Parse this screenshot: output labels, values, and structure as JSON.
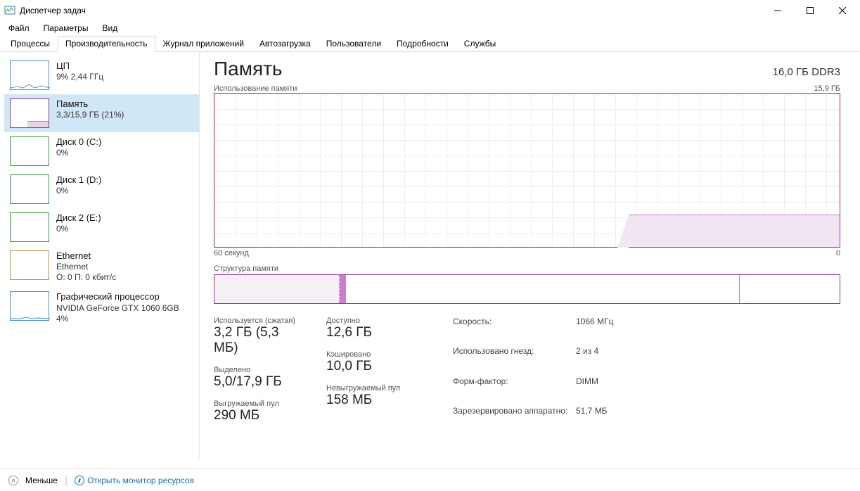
{
  "window": {
    "title": "Диспетчер задач"
  },
  "menu": {
    "file": "Файл",
    "options": "Параметры",
    "view": "Вид"
  },
  "tabs": {
    "processes": "Процессы",
    "performance": "Производительность",
    "app_history": "Журнал приложений",
    "startup": "Автозагрузка",
    "users": "Пользователи",
    "details": "Подробности",
    "services": "Службы"
  },
  "sidebar": {
    "cpu": {
      "title": "ЦП",
      "sub": "9%  2,44 ГГц"
    },
    "memory": {
      "title": "Память",
      "sub": "3,3/15,9 ГБ (21%)"
    },
    "disk0": {
      "title": "Диск 0 (C:)",
      "sub": "0%"
    },
    "disk1": {
      "title": "Диск 1 (D:)",
      "sub": "0%"
    },
    "disk2": {
      "title": "Диск 2 (E:)",
      "sub": "0%"
    },
    "ethernet": {
      "title": "Ethernet",
      "sub1": "Ethernet",
      "sub2": "О: 0 П: 0 кбит/с"
    },
    "gpu": {
      "title": "Графический процессор",
      "sub1": "NVIDIA GeForce GTX 1060 6GB",
      "sub2": "4%"
    }
  },
  "main": {
    "heading": "Память",
    "capacity": "16,0 ГБ DDR3",
    "usage_label": "Использование памяти",
    "usage_max": "15,9 ГБ",
    "axis_left": "60 секунд",
    "axis_right": "0",
    "composition_label": "Структура памяти",
    "stats": {
      "in_use_label": "Используется (сжатая)",
      "in_use_value": "3,2 ГБ (5,3 МБ)",
      "available_label": "Доступно",
      "available_value": "12,6 ГБ",
      "committed_label": "Выделено",
      "committed_value": "5,0/17,9 ГБ",
      "cached_label": "Кэшировано",
      "cached_value": "10,0 ГБ",
      "paged_label": "Выгружаемый пул",
      "paged_value": "290 МБ",
      "nonpaged_label": "Невыгружаемый пул",
      "nonpaged_value": "158 МБ",
      "speed_label": "Скорость:",
      "speed_value": "1066 МГц",
      "slots_label": "Использовано гнезд:",
      "slots_value": "2 из 4",
      "formfactor_label": "Форм-фактор:",
      "formfactor_value": "DIMM",
      "reserved_label": "Зарезервировано аппаратно:",
      "reserved_value": "51,7 МБ"
    }
  },
  "footer": {
    "fewer": "Меньше",
    "open_monitor": "Открыть монитор ресурсов"
  },
  "chart_data": {
    "type": "area",
    "title": "Использование памяти",
    "xlabel": "60 секунд",
    "ylabel": "ГБ",
    "ylim": [
      0,
      15.9
    ],
    "x": [
      60,
      45,
      30,
      20,
      15,
      10,
      5,
      0
    ],
    "values": [
      0,
      0,
      0,
      0,
      3.3,
      3.3,
      3.3,
      3.3
    ],
    "note": "values approximate area fill level; history begins ~20% from right"
  }
}
